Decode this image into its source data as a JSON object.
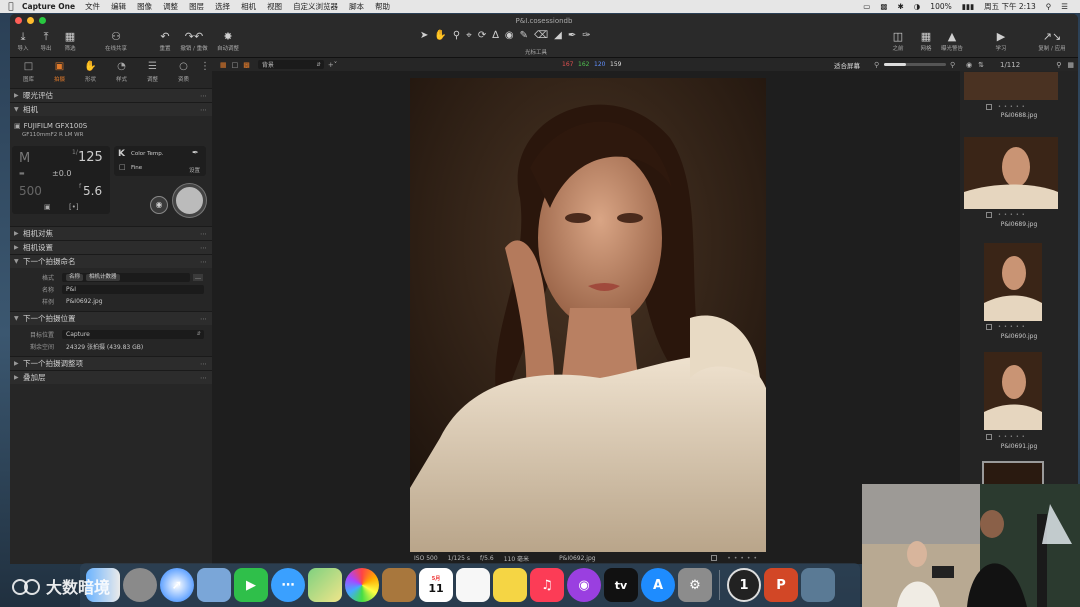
{
  "menubar": {
    "app_name": "Capture One",
    "items": [
      "文件",
      "编辑",
      "图像",
      "调整",
      "图层",
      "选择",
      "相机",
      "视图",
      "自定义浏览器",
      "脚本",
      "帮助"
    ],
    "battery": "100%",
    "clock": "周五 下午 2:13"
  },
  "window": {
    "title": "P&I.cosessiondb"
  },
  "toolbar": {
    "left_buttons": [
      {
        "icon": "import-icon",
        "label": "导入"
      },
      {
        "icon": "export-icon",
        "label": "导出"
      },
      {
        "icon": "filter-icon",
        "label": "筛选"
      },
      {
        "icon": "share-icon",
        "label": "在线共享"
      },
      {
        "icon": "reset-icon",
        "label": "重置"
      },
      {
        "icon": "undo-redo-icon",
        "label": "撤销 / 重做"
      },
      {
        "icon": "auto-adjust-icon",
        "label": "自动调整"
      }
    ],
    "cursor_tools_label": "光标工具",
    "right_buttons": [
      {
        "icon": "before-icon",
        "label": "之前"
      },
      {
        "icon": "grid-icon",
        "label": "网格"
      },
      {
        "icon": "exposure-warning-icon",
        "label": "曝光警告"
      },
      {
        "icon": "learn-icon",
        "label": "学习"
      },
      {
        "icon": "copy-apply-icon",
        "label": "复制 / 应用"
      }
    ]
  },
  "left_panel": {
    "tabs": [
      {
        "icon": "library-icon",
        "label": "图库"
      },
      {
        "icon": "capture-icon",
        "label": "拍摄"
      },
      {
        "icon": "shape-icon",
        "label": "形状"
      },
      {
        "icon": "style-icon",
        "label": "样式"
      },
      {
        "icon": "adjust-icon",
        "label": "调整"
      },
      {
        "icon": "layers-icon",
        "label": "资质"
      }
    ],
    "sections": {
      "exposure_eval": "曝光评估",
      "camera": "相机",
      "camera_focus": "相机对焦",
      "camera_settings": "相机设置",
      "next_capture_naming": "下一个拍摄命名",
      "next_capture_location": "下一个拍摄位置",
      "next_capture_adjustments": "下一个拍摄调整项",
      "overlay": "叠加层"
    },
    "camera": {
      "model": "FUJIFILM GFX100S",
      "lens": "GF110mmF2 R LM WR",
      "mode": "M",
      "shutter": "125",
      "ev": "±0.0",
      "iso": "500",
      "aperture": "5.6",
      "wb_label": "Color Temp.",
      "quality": "Fine",
      "settings_label": "设置"
    },
    "naming": {
      "format_label": "格式",
      "format_tokens": [
        "名称",
        "相机计数器"
      ],
      "name_label": "名称",
      "name_value": "P&I",
      "sample_label": "样例",
      "sample_value": "P&I0692.jpg"
    },
    "location": {
      "target_label": "目标位置",
      "target_value": "Capture",
      "space_label": "剩余空间",
      "space_value": "24329 张拍摄 (439.83 GB)"
    }
  },
  "viewer": {
    "preset": "背景",
    "rgb": {
      "r": "167",
      "g": "162",
      "b": "120",
      "l": "159"
    },
    "fit": "适合屏幕",
    "photo_info": {
      "iso": "ISO 500",
      "shutter": "1/125 s",
      "aperture": "f/5.6",
      "focal": "110 毫米",
      "filename": "P&I0692.jpg"
    }
  },
  "browser": {
    "count": "1/112",
    "thumbs": [
      "P&I0688.jpg",
      "P&I0689.jpg",
      "P&I0690.jpg",
      "P&I0691.jpg"
    ]
  },
  "dock": {
    "apps": [
      {
        "icon": "finder-icon",
        "label": ""
      },
      {
        "icon": "launchpad-icon",
        "label": ""
      },
      {
        "icon": "safari-icon",
        "label": ""
      },
      {
        "icon": "preview-icon",
        "label": ""
      },
      {
        "icon": "facetime-icon",
        "label": ""
      },
      {
        "icon": "messages-icon",
        "label": ""
      },
      {
        "icon": "maps-icon",
        "label": ""
      },
      {
        "icon": "photos-icon",
        "label": ""
      },
      {
        "icon": "contacts-icon",
        "label": ""
      },
      {
        "icon": "calendar-icon",
        "label": "11"
      },
      {
        "icon": "reminders-icon",
        "label": ""
      },
      {
        "icon": "notes-icon",
        "label": ""
      },
      {
        "icon": "music-icon",
        "label": ""
      },
      {
        "icon": "podcasts-icon",
        "label": ""
      },
      {
        "icon": "tv-icon",
        "label": "tv"
      },
      {
        "icon": "appstore-icon",
        "label": ""
      },
      {
        "icon": "system-preferences-icon",
        "label": ""
      },
      {
        "icon": "capture-one-icon",
        "label": "1"
      },
      {
        "icon": "powerpoint-icon",
        "label": "P"
      },
      {
        "icon": "photo-app-icon",
        "label": ""
      }
    ],
    "calendar_month": "5月"
  },
  "watermark": {
    "text": "大数暗境"
  },
  "colors": {
    "accent": "#e07a2b",
    "panel": "#262626",
    "viewer": "#1e1e1e"
  }
}
